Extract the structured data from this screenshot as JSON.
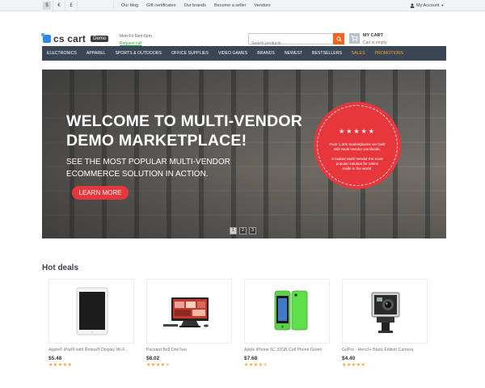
{
  "topbar": {
    "currencies": [
      "$",
      "€",
      "£"
    ],
    "links": [
      "Our blog",
      "Gift certificates",
      "Our brands",
      "Become a seller",
      "Vendors"
    ],
    "account": "My Account"
  },
  "header": {
    "logo_text": "cs cart",
    "demo_badge": "Demo",
    "hours": "Mon-Fri 9am-6pm",
    "callback": "Request call",
    "search_placeholder": "Search products",
    "cart_title": "MY CART",
    "cart_status": "Cart is empty"
  },
  "nav": {
    "items": [
      "ELECTRONICS",
      "APPAREL",
      "SPORTS & OUTDOORS",
      "OFFICE SUPPLIES",
      "VIDEO GAMES",
      "BRANDS",
      "NEWEST",
      "BESTSELLERS",
      "SALES",
      "PROMOTIONS"
    ],
    "highlight_color": "#f5a623",
    "bg_color": "#3a4655"
  },
  "hero": {
    "title_line1": "WELCOME TO MULTI-VENDOR",
    "title_line2": "DEMO MARKETPLACE!",
    "subtitle": "SEE THE MOST POPULAR MULTI-VENDOR ECOMMERCE SOLUTION IN ACTION.",
    "button": "LEARN MORE",
    "badge_stars": "★★★★★",
    "badge_text1": "Over 1,300 marketplaces are built with Multi-Vendor worldwide.",
    "badge_text2": "It makes Multi-Vendor the most popular solution for online malls in the world.",
    "slides": [
      "1",
      "2",
      "3"
    ],
    "accent_color": "#e8363d"
  },
  "hot_deals": {
    "title": "Hot deals",
    "products": [
      {
        "name": "Apple® iPad® with Retina® Display Wi-F...",
        "price": "$5.48",
        "rating": 5,
        "icon": "tablet-image"
      },
      {
        "name": "Packard Bell OneTwo",
        "price": "$8.02",
        "rating": 4.5,
        "icon": "monitor-image"
      },
      {
        "name": "Apple iPhone 5C 32GB Cell Phone Green",
        "price": "$7.68",
        "rating": 4.5,
        "icon": "phone-image"
      },
      {
        "name": "GoPro - Hero3+ Black Edition Camera",
        "price": "$4.40",
        "rating": 5,
        "icon": "camera-image"
      }
    ]
  }
}
